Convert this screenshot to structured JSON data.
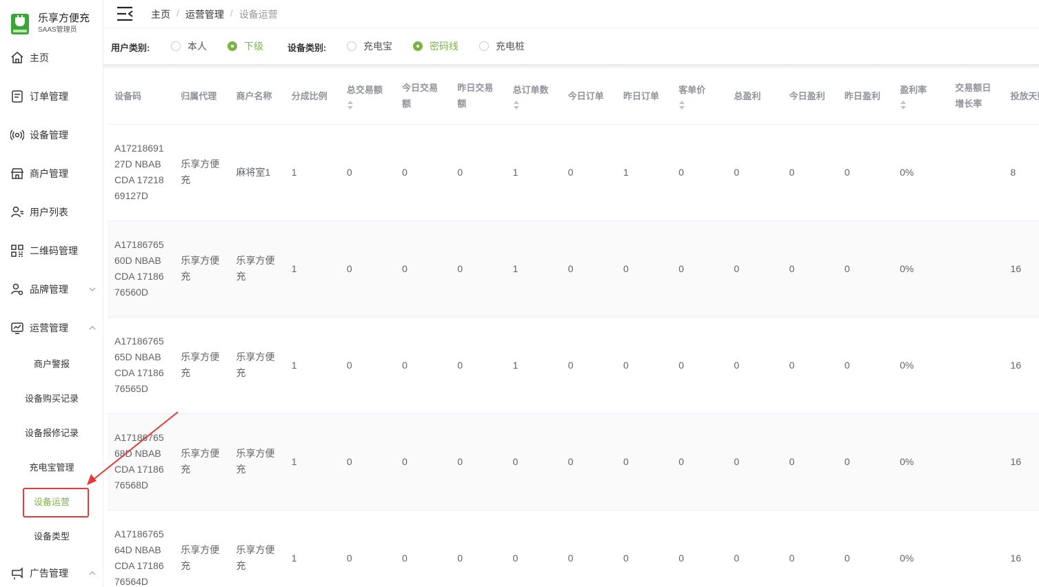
{
  "brand": {
    "title": "乐享方便充",
    "subtitle": "SAAS管理员"
  },
  "sidebar": {
    "items": [
      {
        "label": "主页",
        "icon": "home-icon"
      },
      {
        "label": "订单管理",
        "icon": "order-icon"
      },
      {
        "label": "设备管理",
        "icon": "device-icon"
      },
      {
        "label": "商户管理",
        "icon": "merchant-icon"
      },
      {
        "label": "用户列表",
        "icon": "user-list-icon"
      },
      {
        "label": "二维码管理",
        "icon": "qrcode-icon"
      },
      {
        "label": "品牌管理",
        "icon": "brand-icon",
        "expanded": false
      },
      {
        "label": "运营管理",
        "icon": "operation-icon",
        "expanded": true
      },
      {
        "label": "广告管理",
        "icon": "ad-icon",
        "expanded": true
      }
    ],
    "sub_items": [
      {
        "label": "商户警报"
      },
      {
        "label": "设备购买记录"
      },
      {
        "label": "设备报修记录"
      },
      {
        "label": "充电宝管理"
      },
      {
        "label": "设备运营",
        "active": true
      },
      {
        "label": "设备类型"
      }
    ]
  },
  "breadcrumb": {
    "home": "主页",
    "section": "运营管理",
    "current": "设备运营",
    "separator": "/"
  },
  "filters": {
    "user_type_label": "用户类别:",
    "user_type_options": [
      {
        "label": "本人",
        "selected": false
      },
      {
        "label": "下级",
        "selected": true
      }
    ],
    "device_type_label": "设备类别:",
    "device_type_options": [
      {
        "label": "充电宝",
        "selected": false
      },
      {
        "label": "密码线",
        "selected": true
      },
      {
        "label": "充电桩",
        "selected": false
      }
    ]
  },
  "table": {
    "columns": [
      "设备码",
      "归属代理",
      "商户名称",
      "分成比例",
      "总交易额",
      "今日交易额",
      "昨日交易额",
      "总订单数",
      "今日订单",
      "昨日订单",
      "客单价",
      "总盈利",
      "今日盈利",
      "昨日盈利",
      "盈利率",
      "交易额日增长率",
      "投放天数"
    ],
    "sortable": [
      false,
      false,
      false,
      false,
      true,
      false,
      false,
      true,
      false,
      false,
      true,
      false,
      false,
      false,
      true,
      false,
      false
    ],
    "rows": [
      [
        "A1721869127D NBABCDA 1721869127D",
        "乐享方便充",
        "麻将室1",
        "1",
        "0",
        "0",
        "0",
        "1",
        "0",
        "1",
        "0",
        "0",
        "0",
        "0",
        "0%",
        "",
        "8"
      ],
      [
        "A1718676560D NBABCDA 1718676560D",
        "乐享方便充",
        "乐享方便充",
        "1",
        "0",
        "0",
        "0",
        "1",
        "0",
        "0",
        "0",
        "0",
        "0",
        "0",
        "0%",
        "",
        "16"
      ],
      [
        "A1718676565D NBABCDA 1718676565D",
        "乐享方便充",
        "乐享方便充",
        "1",
        "0",
        "0",
        "0",
        "1",
        "0",
        "0",
        "0",
        "0",
        "0",
        "0",
        "0%",
        "",
        "16"
      ],
      [
        "A1718676568D NBABCDA 1718676568D",
        "乐享方便充",
        "乐享方便充",
        "1",
        "0",
        "0",
        "0",
        "0",
        "0",
        "0",
        "0",
        "0",
        "0",
        "0",
        "0%",
        "",
        "16"
      ],
      [
        "A1718676564D NBABCDA 1718676564D",
        "乐享方便充",
        "乐享方便充",
        "1",
        "0",
        "0",
        "0",
        "0",
        "0",
        "0",
        "0",
        "0",
        "0",
        "0",
        "0%",
        "",
        "16"
      ]
    ]
  },
  "colors": {
    "accent": "#7cb342",
    "brand": "#3aa637",
    "highlight": "#e53935"
  }
}
